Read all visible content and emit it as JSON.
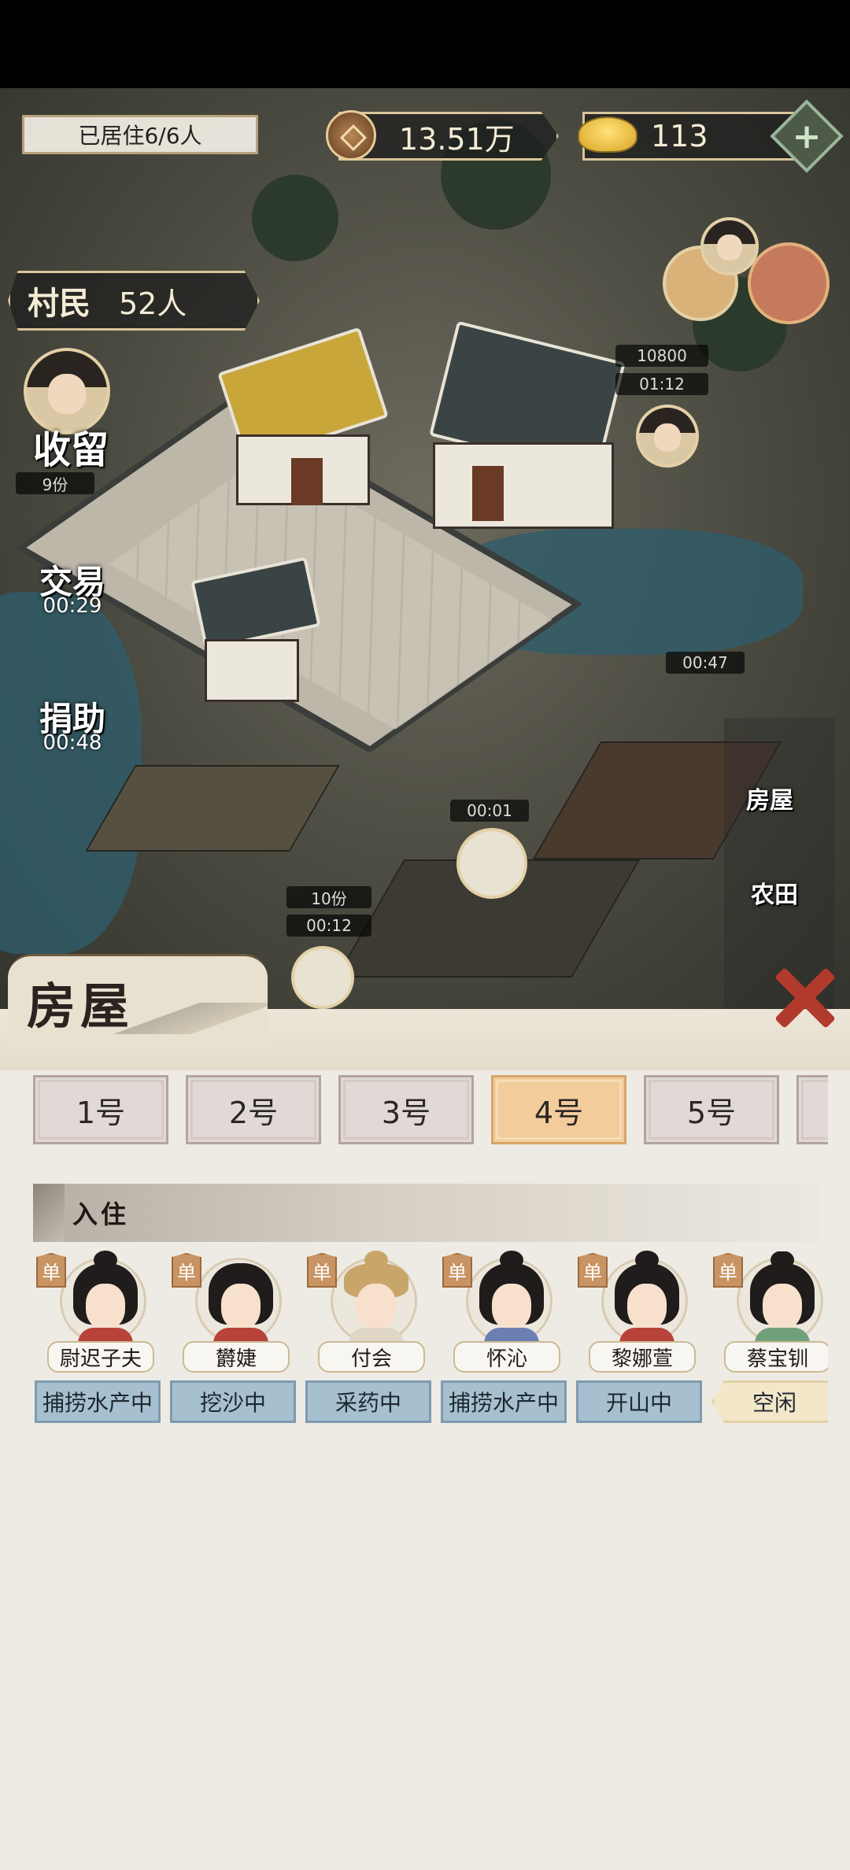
{
  "hud": {
    "residents_status": "已居住6/6人",
    "copper_coins": "13.51万",
    "gold_ingots": "113",
    "plus_label": "+",
    "villagers_label": "村民",
    "villagers_count": "52人"
  },
  "side_buttons": {
    "shelter": "收留",
    "shelter_count": "9份",
    "trade": "交易",
    "trade_timer": "00:29",
    "donate": "捐助",
    "donate_timer": "00:48"
  },
  "map_timers": {
    "t1_value": "10800",
    "t1_time": "01:12",
    "t2_time": "00:47",
    "t3_time": "00:01",
    "t4_count": "10份",
    "t4_time": "00:12"
  },
  "right_menu": {
    "house": "房屋",
    "farmland": "农田"
  },
  "panel": {
    "title": "房屋",
    "tabs": [
      "1号",
      "2号",
      "3号",
      "4号",
      "5号"
    ],
    "active_tab_index": 3,
    "section_label": "入住",
    "single_tag": "单",
    "residents": [
      {
        "name": "尉迟子夫",
        "status": "捕捞水产中"
      },
      {
        "name": "欝婕",
        "status": "挖沙中"
      },
      {
        "name": "付会",
        "status": "采药中"
      },
      {
        "name": "怀沁",
        "status": "捕捞水产中"
      },
      {
        "name": "黎娜萱",
        "status": "开山中"
      },
      {
        "name": "蔡宝钏",
        "status": "空闲"
      }
    ]
  },
  "colors": {
    "tab_active": "#f2cc9b",
    "status_busy": "#a7c0d0",
    "status_idle": "#f3e6c9",
    "close_red": "#b23a2c"
  }
}
